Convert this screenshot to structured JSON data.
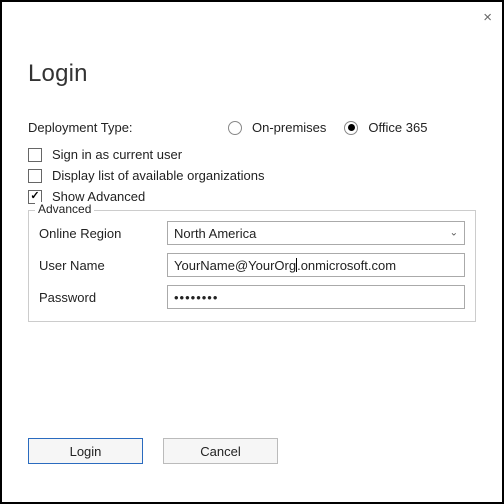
{
  "close_icon": "×",
  "title": "Login",
  "deployment": {
    "label": "Deployment Type:",
    "options": {
      "on_prem": "On-premises",
      "office365": "Office 365"
    },
    "selected": "office365"
  },
  "checks": {
    "sign_in_current": "Sign in as current user",
    "display_orgs": "Display list of available organizations",
    "show_advanced": "Show Advanced"
  },
  "advanced": {
    "legend": "Advanced",
    "online_region_label": "Online Region",
    "online_region_value": "North America",
    "username_label": "User Name",
    "username_pre": "YourName@YourOrg",
    "username_post": ".onmicrosoft.com",
    "password_label": "Password",
    "password_value": "••••••••"
  },
  "buttons": {
    "login": "Login",
    "cancel": "Cancel"
  }
}
